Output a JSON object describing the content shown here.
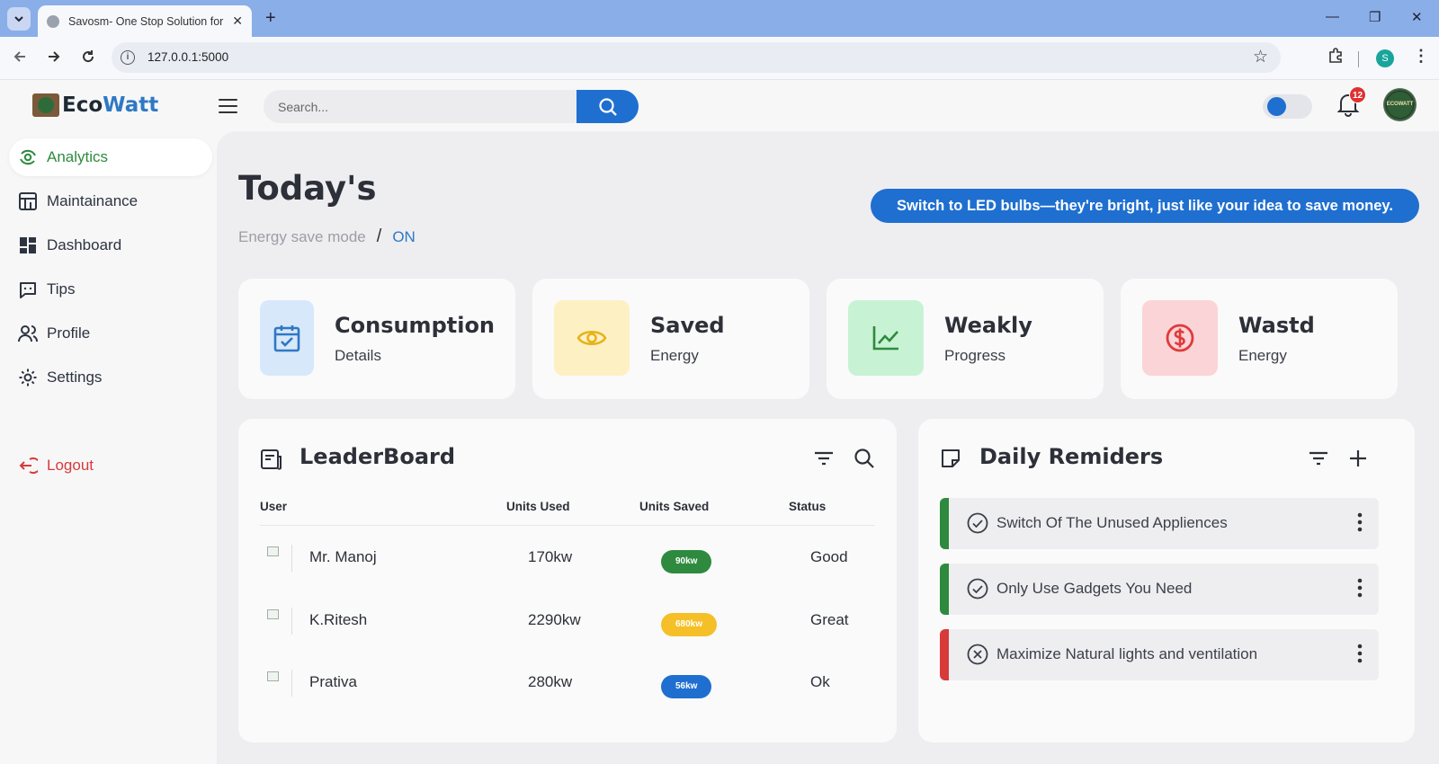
{
  "browser": {
    "tab_title": "Savosm- One Stop Solution for",
    "tab_close": "✕",
    "new_tab": "+",
    "url": "127.0.0.1:5000",
    "profile_initial": "S",
    "minimize": "—",
    "restore": "❐",
    "close": "✕"
  },
  "header": {
    "logo_eco": "Eco",
    "logo_watt": "Watt",
    "search_placeholder": "Search...",
    "notification_count": "12",
    "avatar_text": "ECOWATT",
    "theme_toggle_on": true
  },
  "sidebar": {
    "items": [
      {
        "label": "Analytics",
        "icon": "analytics-icon",
        "active": true
      },
      {
        "label": "Maintainance",
        "icon": "store-icon",
        "active": false
      },
      {
        "label": "Dashboard",
        "icon": "dashboard-icon",
        "active": false
      },
      {
        "label": "Tips",
        "icon": "chat-bubble-icon",
        "active": false
      },
      {
        "label": "Profile",
        "icon": "users-icon",
        "active": false
      },
      {
        "label": "Settings",
        "icon": "gear-icon",
        "active": false
      }
    ],
    "logout": "Logout"
  },
  "main": {
    "title": "Today's",
    "mode_label": "Energy save mode",
    "mode_sep": "/",
    "mode_value": "ON",
    "tip": "Switch to LED bulbs—they're bright, just like your idea to save money."
  },
  "cards": [
    {
      "title": "Consumption",
      "subtitle": "Details",
      "icon": "calendar-check-icon",
      "bg": "#d7e8fb",
      "fg": "#2f78c4"
    },
    {
      "title": "Saved",
      "subtitle": "Energy",
      "icon": "eye-icon",
      "bg": "#fdf1c4",
      "fg": "#e7b21b"
    },
    {
      "title": "Weakly",
      "subtitle": "Progress",
      "icon": "line-chart-icon",
      "bg": "#c8f2d4",
      "fg": "#2e8a3e"
    },
    {
      "title": "Wastd",
      "subtitle": "Energy",
      "icon": "dollar-circle-icon",
      "bg": "#fbd4d8",
      "fg": "#e03a3a"
    }
  ],
  "leaderboard": {
    "title": "LeaderBoard",
    "columns": [
      "User",
      "Units Used",
      "Units Saved",
      "Status"
    ],
    "rows": [
      {
        "user": "Mr. Manoj",
        "used": "170kw",
        "saved": "90kw",
        "saved_color": "#2e8a3e",
        "status": "Good"
      },
      {
        "user": "K.Ritesh",
        "used": "2290kw",
        "saved": "680kw",
        "saved_color": "#f5c027",
        "status": "Great"
      },
      {
        "user": "Prativa",
        "used": "280kw",
        "saved": "56kw",
        "saved_color": "#1f6fd0",
        "status": "Ok"
      }
    ]
  },
  "reminders": {
    "title": "Daily Remiders",
    "items": [
      {
        "text": "Switch Of The Unused Appliences",
        "state": "done",
        "color": "#2e8a3e"
      },
      {
        "text": "Only Use Gadgets You Need",
        "state": "done",
        "color": "#2e8a3e"
      },
      {
        "text": "Maximize Natural lights and ventilation",
        "state": "missed",
        "color": "#d83a3a"
      }
    ]
  }
}
